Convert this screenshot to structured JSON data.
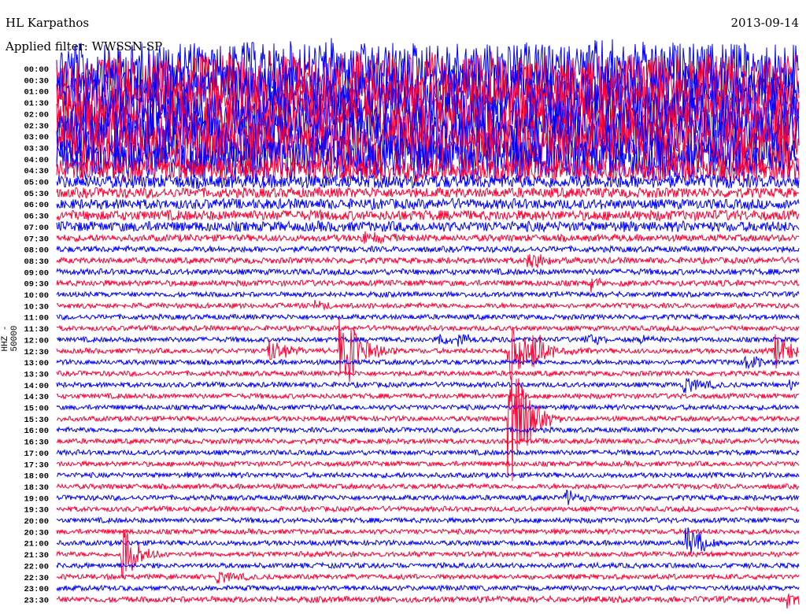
{
  "header": {
    "station": "HL Karpathos",
    "date": "2013-09-14",
    "filter_label": "Applied filter: WWSSN-SP",
    "channel_label": "HHZ - 50000"
  },
  "colors": {
    "even_trace": "#0000ff",
    "odd_trace": "#ff0033"
  },
  "chart_data": {
    "type": "line",
    "title": "HL Karpathos 2013-09-14",
    "minutes_per_trace": 30,
    "trace_labels": [
      "00:00",
      "00:30",
      "01:00",
      "01:30",
      "02:00",
      "02:30",
      "03:00",
      "03:30",
      "04:00",
      "04:30",
      "05:00",
      "05:30",
      "06:00",
      "06:30",
      "07:00",
      "07:30",
      "08:00",
      "08:30",
      "09:00",
      "09:30",
      "10:00",
      "10:30",
      "11:00",
      "11:30",
      "12:00",
      "12:30",
      "13:00",
      "13:30",
      "14:00",
      "14:30",
      "15:00",
      "15:30",
      "16:00",
      "16:30",
      "17:00",
      "17:30",
      "18:00",
      "18:30",
      "19:00",
      "19:30",
      "20:00",
      "20:30",
      "21:00",
      "21:30",
      "22:00",
      "22:30",
      "23:00",
      "23:30"
    ],
    "noise_level": [
      26,
      26,
      26,
      26,
      26,
      26,
      26,
      26,
      22,
      12,
      8,
      6,
      6,
      6,
      6,
      4,
      3.5,
      3.5,
      3.5,
      3.5,
      3,
      3,
      3,
      3,
      3,
      3,
      3,
      3,
      3,
      3,
      3,
      3,
      3,
      3,
      3,
      3,
      3,
      3,
      3,
      3,
      3,
      3,
      3,
      3,
      3,
      3,
      3,
      3.5
    ],
    "events": [
      {
        "trace": "07:30",
        "minute": 12.3,
        "amplitude": 10
      },
      {
        "trace": "08:30",
        "minute": 19.0,
        "amplitude": 15
      },
      {
        "trace": "09:30",
        "minute": 21.6,
        "amplitude": 10
      },
      {
        "trace": "10:30",
        "minute": 10.4,
        "amplitude": 6
      },
      {
        "trace": "12:00",
        "minute": 15.4,
        "amplitude": 10
      },
      {
        "trace": "12:00",
        "minute": 16.2,
        "amplitude": 10
      },
      {
        "trace": "12:00",
        "minute": 21.1,
        "amplitude": 12
      },
      {
        "trace": "12:00",
        "minute": 23.5,
        "amplitude": 7
      },
      {
        "trace": "12:30",
        "minute": 8.5,
        "amplitude": 20
      },
      {
        "trace": "12:30",
        "minute": 11.4,
        "amplitude": 80
      },
      {
        "trace": "12:30",
        "minute": 18.2,
        "amplitude": 50
      },
      {
        "trace": "12:30",
        "minute": 19.2,
        "amplitude": 30
      },
      {
        "trace": "12:30",
        "minute": 29.0,
        "amplitude": 25
      },
      {
        "trace": "13:00",
        "minute": 27.8,
        "amplitude": 12
      },
      {
        "trace": "14:00",
        "minute": 25.3,
        "amplitude": 15
      },
      {
        "trace": "14:00",
        "minute": 29.5,
        "amplitude": 8
      },
      {
        "trace": "15:30",
        "minute": 18.2,
        "amplitude": 120
      },
      {
        "trace": "19:00",
        "minute": 20.5,
        "amplitude": 10
      },
      {
        "trace": "21:00",
        "minute": 25.4,
        "amplitude": 30
      },
      {
        "trace": "21:30",
        "minute": 2.6,
        "amplitude": 45
      },
      {
        "trace": "22:30",
        "minute": 6.4,
        "amplitude": 12
      },
      {
        "trace": "23:30",
        "minute": 29.5,
        "amplitude": 12
      }
    ]
  }
}
